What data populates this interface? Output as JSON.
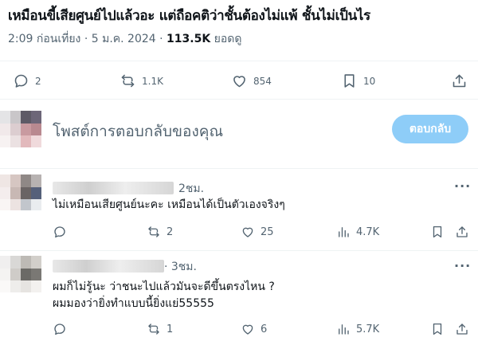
{
  "post": {
    "text": "เหมือนขี้เสียศูนย์ไปแล้วอะ แต่ถือคติว่าชั้นต้องไม่แพ้ ชั้นไม่เป็นไร",
    "time": "2:09 ก่อนเที่ยง · 5 ม.ค. 2024 ·",
    "views": "113.5K",
    "views_label": "ยอดดู",
    "replies": "2",
    "reposts": "1.1K",
    "likes": "854",
    "bookmarks": "10"
  },
  "composer": {
    "placeholder": "โพสต์การตอบกลับของคุณ",
    "button": "ตอบกลับ"
  },
  "replies": [
    {
      "time": "2ชม.",
      "text": "ไม่เหมือนเสียศูนย์นะคะ เหมือนได้เป็นตัวเองจริงๆ",
      "replies": "",
      "reposts": "2",
      "likes": "25",
      "views": "4.7K"
    },
    {
      "time": "· 3ชม.",
      "text_line1": "ผมก็ไม่รู้นะ ว่าชนะไปแล้วมันจะดีขึ้นตรงไหน ?",
      "text_line2": "ผมมองว่ายิ่งทำแบบนี้ยิ่งแย่55555",
      "replies": "",
      "reposts": "1",
      "likes": "6",
      "views": "5.7K"
    }
  ],
  "more_label": "···"
}
